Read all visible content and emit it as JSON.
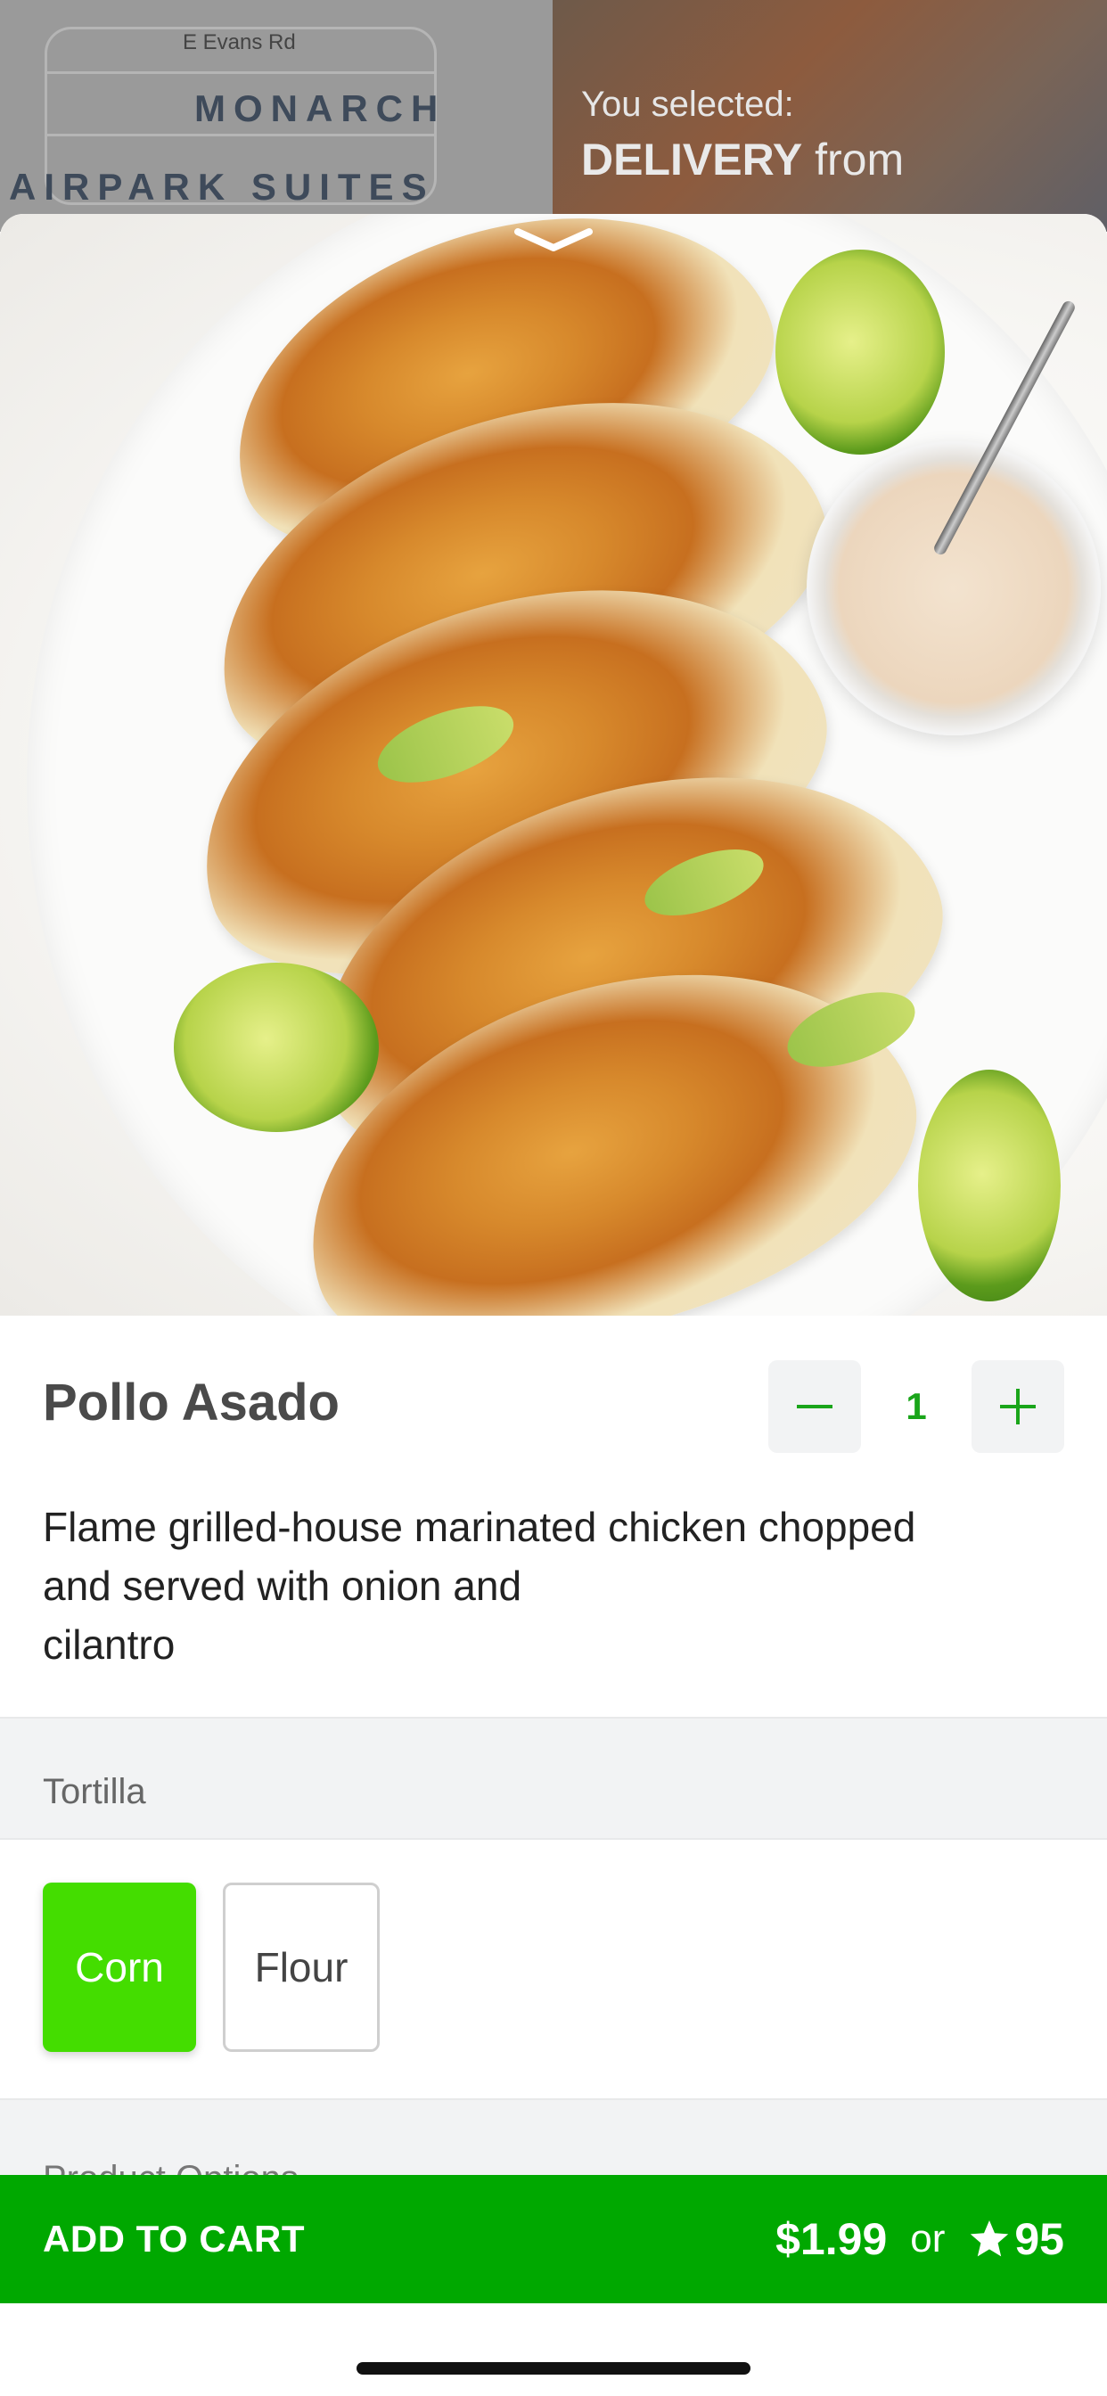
{
  "background": {
    "map": {
      "street": "E Evans Rd",
      "place_line1": "MONARCH",
      "place_line2": "AIRPARK SUITES"
    },
    "banner": {
      "label": "You selected:",
      "mode": "DELIVERY",
      "suffix": "from"
    }
  },
  "product": {
    "name": "Pollo Asado",
    "quantity": "1",
    "decrement_symbol": "−",
    "increment_symbol": "+",
    "description": "Flame grilled-house marinated chicken chopped\nand served with onion and\ncilantro"
  },
  "tortilla": {
    "section_label": "Tortilla",
    "options": [
      {
        "label": "Corn",
        "selected": true
      },
      {
        "label": "Flour",
        "selected": false
      }
    ]
  },
  "product_options": {
    "section_label": "Product Options"
  },
  "cart": {
    "label": "ADD TO CART",
    "price": "$1.99",
    "or": "or",
    "points": "95"
  },
  "colors": {
    "brand_green": "#00a800",
    "selected_choice": "#44dd00",
    "qty_green": "#1aa51a"
  },
  "icons": [
    "chevron-down-icon",
    "minus-icon",
    "plus-icon",
    "star-icon"
  ]
}
